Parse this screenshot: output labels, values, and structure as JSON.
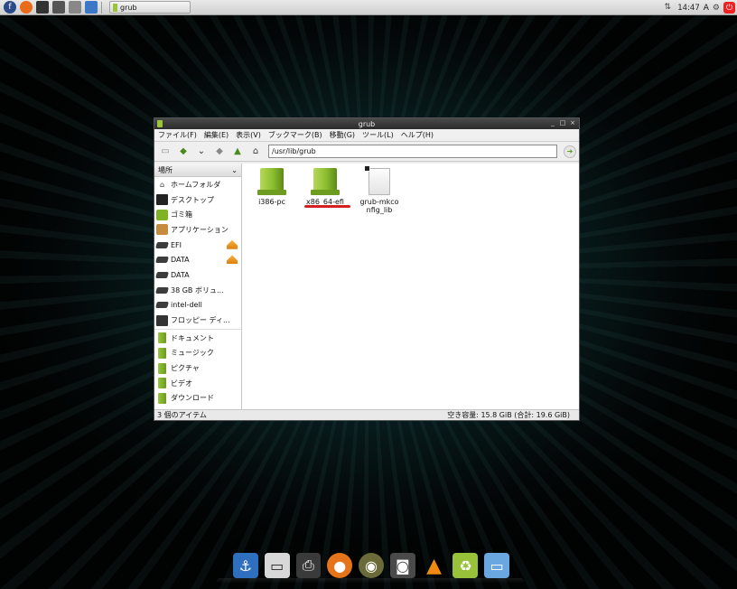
{
  "top_panel": {
    "launchers": [
      "fedora-icon",
      "firefox-icon",
      "terminal-icon",
      "monitor-icon",
      "screen-icon",
      "window-icon"
    ],
    "task": {
      "label": "grub"
    },
    "clock": "14:47",
    "input_method": "A",
    "power_icon": "power-icon"
  },
  "window": {
    "title": "grub",
    "controls": [
      "_",
      "□",
      "×"
    ],
    "menu": [
      "ファイル(F)",
      "編集(E)",
      "表示(V)",
      "ブックマーク(B)",
      "移動(G)",
      "ツール(L)",
      "ヘルプ(H)"
    ],
    "toolbar": {
      "buttons": [
        "new-tab-icon",
        "back-icon",
        "dropdown-icon",
        "forward-icon",
        "up-icon",
        "home-icon"
      ],
      "path": "/usr/lib/grub"
    },
    "sidebar": {
      "header": "場所",
      "places": [
        {
          "label": "ホームフォルダ",
          "icon": "home-icon",
          "eject": false
        },
        {
          "label": "デスクトップ",
          "icon": "desktop-icon",
          "eject": false
        },
        {
          "label": "ゴミ箱",
          "icon": "trash-icon",
          "eject": false
        },
        {
          "label": "アプリケーション",
          "icon": "applications-icon",
          "eject": false
        },
        {
          "label": "EFI",
          "icon": "drive-icon",
          "eject": true
        },
        {
          "label": "DATA",
          "icon": "drive-icon",
          "eject": true
        },
        {
          "label": "DATA",
          "icon": "drive-icon",
          "eject": false
        },
        {
          "label": "38 GB ボリュ...",
          "icon": "drive-icon",
          "eject": false
        },
        {
          "label": "intel-dell",
          "icon": "drive-icon",
          "eject": false
        },
        {
          "label": "フロッピー ディ...",
          "icon": "floppy-icon",
          "eject": false
        }
      ],
      "bookmarks": [
        {
          "label": "ドキュメント",
          "icon": "folder-icon"
        },
        {
          "label": "ミュージック",
          "icon": "folder-icon"
        },
        {
          "label": "ピクチャ",
          "icon": "folder-icon"
        },
        {
          "label": "ビデオ",
          "icon": "folder-icon"
        },
        {
          "label": "ダウンロード",
          "icon": "folder-icon"
        }
      ]
    },
    "files": [
      {
        "name": "i386-pc",
        "type": "folder"
      },
      {
        "name": "x86_64-efi",
        "type": "folder",
        "highlighted": true
      },
      {
        "name": "grub-mkconfig_lib",
        "type": "file"
      }
    ],
    "status": {
      "left": "3 個のアイテム",
      "right": "空き容量: 15.8 GiB (合計: 19.6 GiB)"
    }
  },
  "dock": [
    "anchor-icon",
    "monitor-icon",
    "printer-icon",
    "firefox-icon",
    "disc-icon",
    "camera-icon",
    "vlc-icon",
    "trash-icon",
    "computer-icon"
  ],
  "colors": {
    "accent_green": "#8bbd2e",
    "highlight_red": "#d42020"
  }
}
